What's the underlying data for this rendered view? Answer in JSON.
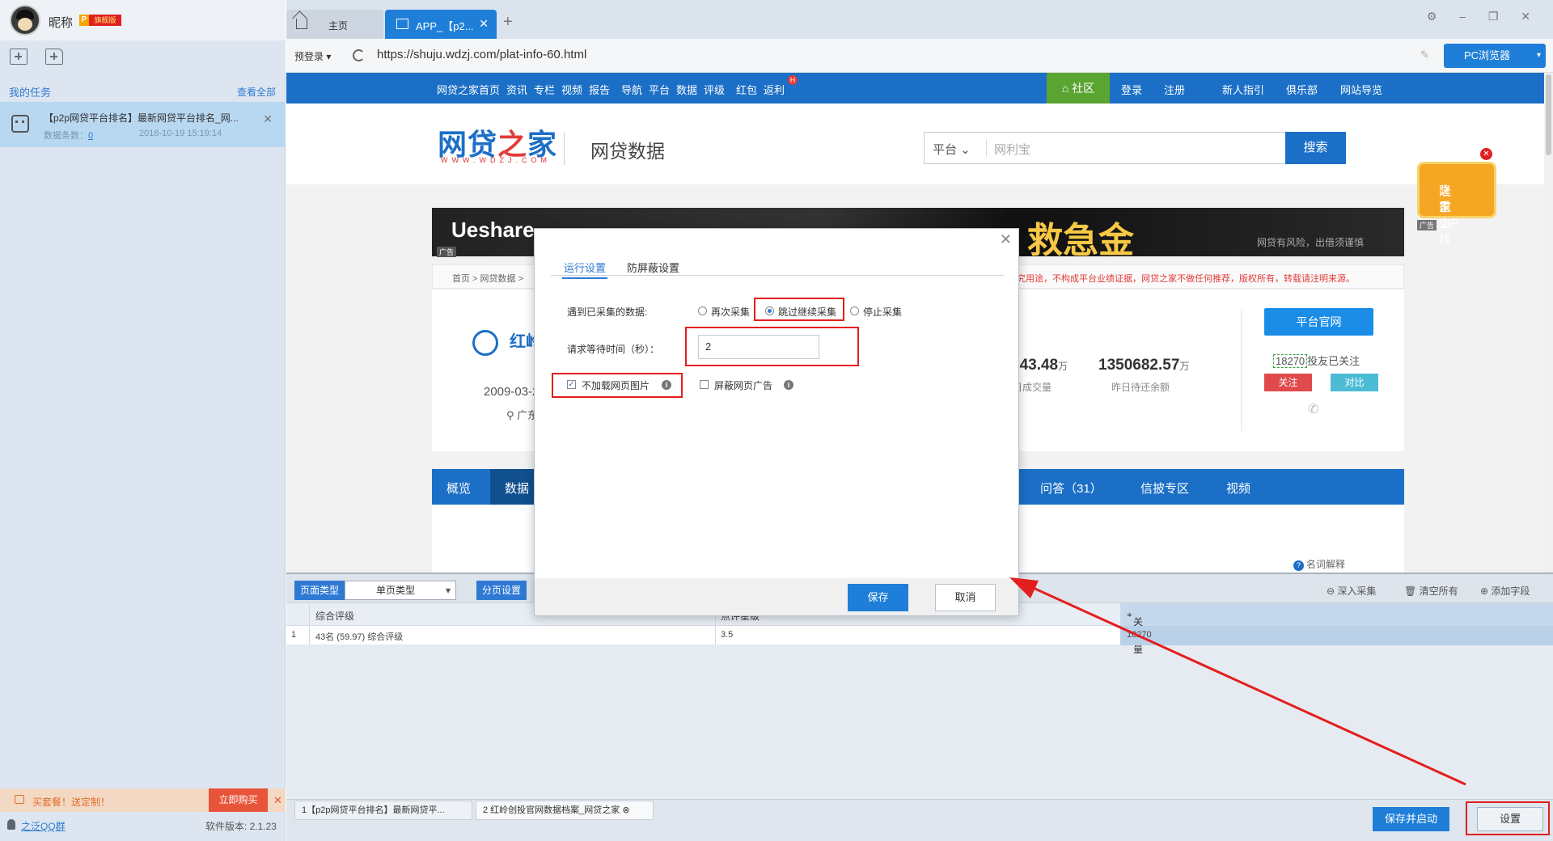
{
  "user": {
    "nickname": "昵称",
    "vip_letter": "P",
    "vip_label": "旗舰版"
  },
  "sidebar": {
    "my_tasks": "我的任务",
    "view_all": "查看全部",
    "task": {
      "name": "【p2p网贷平台排名】最新网贷平台排名_网...",
      "count_label": "数据条数：",
      "count": "0",
      "time": "2018-10-19 15:19:14"
    },
    "promo_text": "买套餐！送定制！",
    "buy_button": "立即购买",
    "qq_group": "之泛QQ群",
    "version": "软件版本: 2.1.23"
  },
  "browser": {
    "tabs": [
      {
        "label": "主页"
      },
      {
        "label": "APP_【p2..."
      }
    ],
    "prelogin": "预登录 ▾",
    "url": "https://shuju.wdzj.com/plat-info-60.html",
    "pc_browser": "PC浏览器"
  },
  "site": {
    "nav": [
      "网贷之家首页",
      "资讯",
      "专栏",
      "视频",
      "报告",
      "导航",
      "平台",
      "数据",
      "评级",
      "红包",
      "返利"
    ],
    "nav_hot": "H",
    "nav_right": [
      "社区",
      "登录",
      "注册",
      "新人指引",
      "俱乐部",
      "网站导览"
    ],
    "logo": {
      "main_a": "网贷",
      "main_b": "之",
      "main_c": "家",
      "sub": "WWW.WDZJ.COM",
      "section": "网贷数据"
    },
    "search": {
      "category": "平台 ⌄",
      "placeholder": "网利宝",
      "button": "搜索"
    },
    "ad": {
      "brand": "Ueshare",
      "slogan": "救急金",
      "risk": "网贷有风险，出借须谨慎",
      "tag": "广告"
    },
    "breadcrumb": "首页 > 网贷数据 >",
    "warning": "究用途，不构成平台业绩证据，网贷之家不做任何推荐，版权所有，转载请注明来源。",
    "platform": {
      "name": "红岭",
      "date": "2009-03-2",
      "location": "广东"
    },
    "stats": [
      {
        "value": "243.48",
        "unit": "万",
        "label": "日成交量"
      },
      {
        "value": "1350682.57",
        "unit": "万",
        "label": "昨日待还余额"
      }
    ],
    "official_button": "平台官网",
    "followers_count": "18270",
    "followers_label": "投友已关注",
    "follow_button": "关注",
    "compare_button": "对比",
    "tabs": [
      "概览",
      "数据",
      "问答（31）",
      "信披专区",
      "视频"
    ],
    "term": "名词解释",
    "vip_float": {
      "line1": "之家VIP",
      "line2": "隆重上线",
      "tag": "广告"
    }
  },
  "panel": {
    "page_type_label": "页面类型",
    "page_type_value": "单页类型",
    "paging_label": "分页设置",
    "actions": [
      "深入采集",
      "清空所有",
      "添加字段"
    ],
    "columns": [
      "综合评级",
      "点评星级",
      "关注量"
    ],
    "rows": [
      {
        "index": "1",
        "cells": [
          "43名 (59.97) 综合评级",
          "3.5",
          "18270"
        ]
      }
    ]
  },
  "bottom": {
    "tabs": [
      "1【p2p网贷平台排名】最新网贷平...",
      "2 红岭创投官网数据档案_网贷之家"
    ],
    "save_start": "保存并启动",
    "settings": "设置"
  },
  "dialog": {
    "tabs": [
      "运行设置",
      "防屏蔽设置"
    ],
    "collected_label": "遇到已采集的数据:",
    "options": [
      "再次采集",
      "跳过继续采集",
      "停止采集"
    ],
    "selected_option": "跳过继续采集",
    "wait_label": "请求等待时间（秒）：",
    "wait_value": "2",
    "no_images_label": "不加载网页图片",
    "no_images_checked": true,
    "block_ads_label": "屏蔽网页广告",
    "block_ads_checked": false,
    "save": "保存",
    "cancel": "取消"
  },
  "colors": {
    "accent": "#1f7fd8",
    "site_blue": "#1b6fc6",
    "annotation_red": "#e41e1e"
  }
}
